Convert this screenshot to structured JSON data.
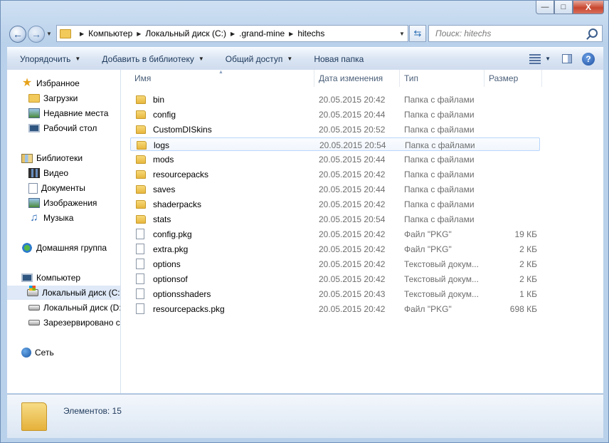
{
  "window": {
    "minimize_glyph": "—",
    "maximize_glyph": "□",
    "close_glyph": "X"
  },
  "address_bar": {
    "crumbs": [
      "Компьютер",
      "Локальный диск (C:)",
      ".grand-mine",
      "hitechs"
    ]
  },
  "search": {
    "placeholder": "Поиск: hitechs"
  },
  "toolbar": {
    "organize": "Упорядочить",
    "add_to_library": "Добавить в библиотеку",
    "share": "Общий доступ",
    "new_folder": "Новая папка",
    "help": "?"
  },
  "nav": {
    "favorites": "Избранное",
    "downloads": "Загрузки",
    "recent": "Недавние места",
    "desktop": "Рабочий стол",
    "libraries": "Библиотеки",
    "video": "Видео",
    "documents": "Документы",
    "pictures": "Изображения",
    "music": "Музыка",
    "homegroup": "Домашняя группа",
    "computer": "Компьютер",
    "drive_c": "Локальный диск (C:)",
    "drive_d": "Локальный диск (D:)",
    "reserved": "Зарезервировано системой",
    "network": "Сеть"
  },
  "columns": {
    "name": "Имя",
    "date": "Дата изменения",
    "type": "Тип",
    "size": "Размер"
  },
  "files": [
    {
      "name": "bin",
      "date": "20.05.2015 20:42",
      "type": "Папка с файлами",
      "size": "",
      "kind": "folder"
    },
    {
      "name": "config",
      "date": "20.05.2015 20:44",
      "type": "Папка с файлами",
      "size": "",
      "kind": "folder"
    },
    {
      "name": "CustomDISkins",
      "date": "20.05.2015 20:52",
      "type": "Папка с файлами",
      "size": "",
      "kind": "folder"
    },
    {
      "name": "logs",
      "date": "20.05.2015 20:54",
      "type": "Папка с файлами",
      "size": "",
      "kind": "folder"
    },
    {
      "name": "mods",
      "date": "20.05.2015 20:44",
      "type": "Папка с файлами",
      "size": "",
      "kind": "folder"
    },
    {
      "name": "resourcepacks",
      "date": "20.05.2015 20:42",
      "type": "Папка с файлами",
      "size": "",
      "kind": "folder"
    },
    {
      "name": "saves",
      "date": "20.05.2015 20:44",
      "type": "Папка с файлами",
      "size": "",
      "kind": "folder"
    },
    {
      "name": "shaderpacks",
      "date": "20.05.2015 20:42",
      "type": "Папка с файлами",
      "size": "",
      "kind": "folder"
    },
    {
      "name": "stats",
      "date": "20.05.2015 20:54",
      "type": "Папка с файлами",
      "size": "",
      "kind": "folder"
    },
    {
      "name": "config.pkg",
      "date": "20.05.2015 20:42",
      "type": "Файл \"PKG\"",
      "size": "19 КБ",
      "kind": "file"
    },
    {
      "name": "extra.pkg",
      "date": "20.05.2015 20:42",
      "type": "Файл \"PKG\"",
      "size": "2 КБ",
      "kind": "file"
    },
    {
      "name": "options",
      "date": "20.05.2015 20:42",
      "type": "Текстовый докум...",
      "size": "2 КБ",
      "kind": "file"
    },
    {
      "name": "optionsof",
      "date": "20.05.2015 20:42",
      "type": "Текстовый докум...",
      "size": "2 КБ",
      "kind": "file"
    },
    {
      "name": "optionsshaders",
      "date": "20.05.2015 20:43",
      "type": "Текстовый докум...",
      "size": "1 КБ",
      "kind": "file"
    },
    {
      "name": "resourcepacks.pkg",
      "date": "20.05.2015 20:42",
      "type": "Файл \"PKG\"",
      "size": "698 КБ",
      "kind": "file"
    }
  ],
  "status": {
    "items_count": "Элементов: 15"
  }
}
